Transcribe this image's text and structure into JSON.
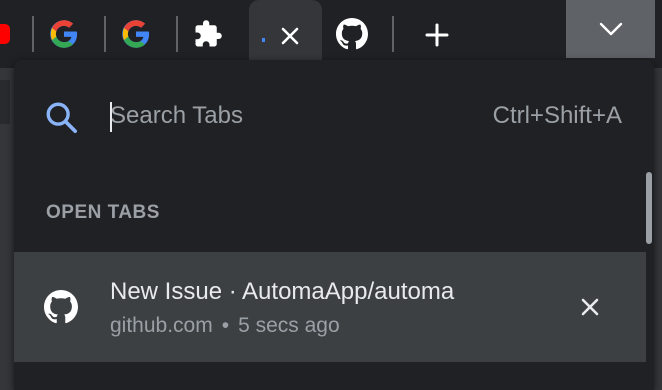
{
  "colors": {
    "tabstrip_bg": "#202124",
    "panel_bg": "#202124",
    "row_selected_bg": "#3c4043",
    "accent_blue": "#8ab4f8",
    "text_primary": "#e8eaed",
    "text_secondary": "#9aa0a6"
  },
  "tabstrip": {
    "tabs": [
      {
        "icon": "youtube-icon"
      },
      {
        "icon": "google-icon"
      },
      {
        "icon": "google-icon"
      },
      {
        "icon": "puzzle-extension-icon"
      },
      {
        "icon": "close-icon"
      },
      {
        "icon": "github-icon"
      }
    ],
    "new_tab_icon": "plus-icon",
    "tab_search_icon": "chevron-down-icon"
  },
  "search": {
    "placeholder": "Search Tabs",
    "value": "",
    "shortcut": "Ctrl+Shift+A",
    "icon": "search-icon"
  },
  "open_tabs": {
    "section_title": "OPEN TABS",
    "items": [
      {
        "title": "New Issue · AutomaApp/automa",
        "domain": "github.com",
        "separator": "•",
        "time": "5 secs ago",
        "icon": "github-icon",
        "close_icon": "close-icon"
      }
    ]
  }
}
